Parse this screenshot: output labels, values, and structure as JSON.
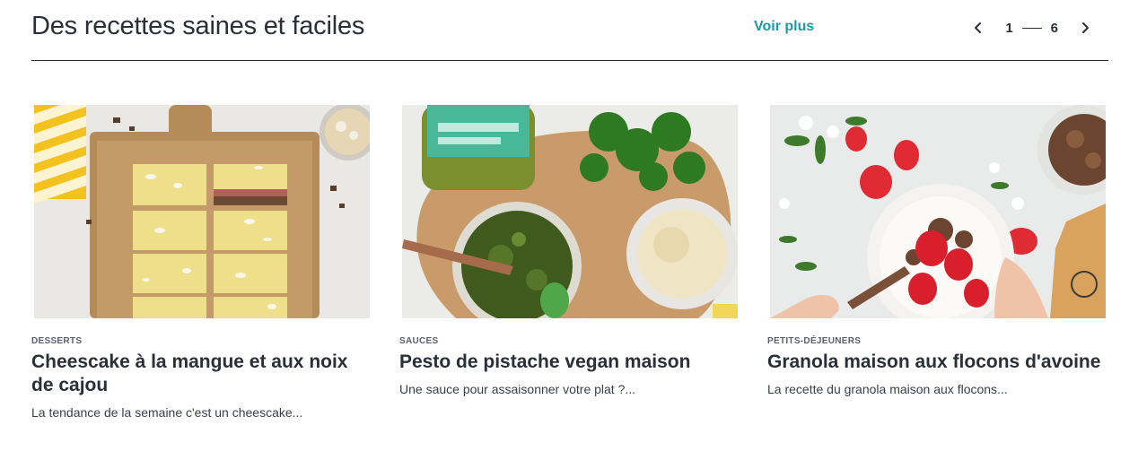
{
  "header": {
    "title": "Des recettes saines et faciles",
    "see_more_label": "Voir plus",
    "pager": {
      "current": "1",
      "total": "6"
    }
  },
  "colors": {
    "accent": "#1c9aa6",
    "text": "#2b2f38"
  },
  "cards": [
    {
      "category": "DESSERTS",
      "title": "Cheescake à la mangue et aux noix de cajou",
      "excerpt": "La tendance de la semaine c'est un cheescake..."
    },
    {
      "category": "SAUCES",
      "title": "Pesto de pistache vegan maison",
      "excerpt": "Une sauce pour assaisonner votre plat ?..."
    },
    {
      "category": "PETITS-DÉJEUNERS",
      "title": "Granola maison aux flocons d'avoine",
      "excerpt": "La recette du granola maison aux flocons..."
    }
  ]
}
